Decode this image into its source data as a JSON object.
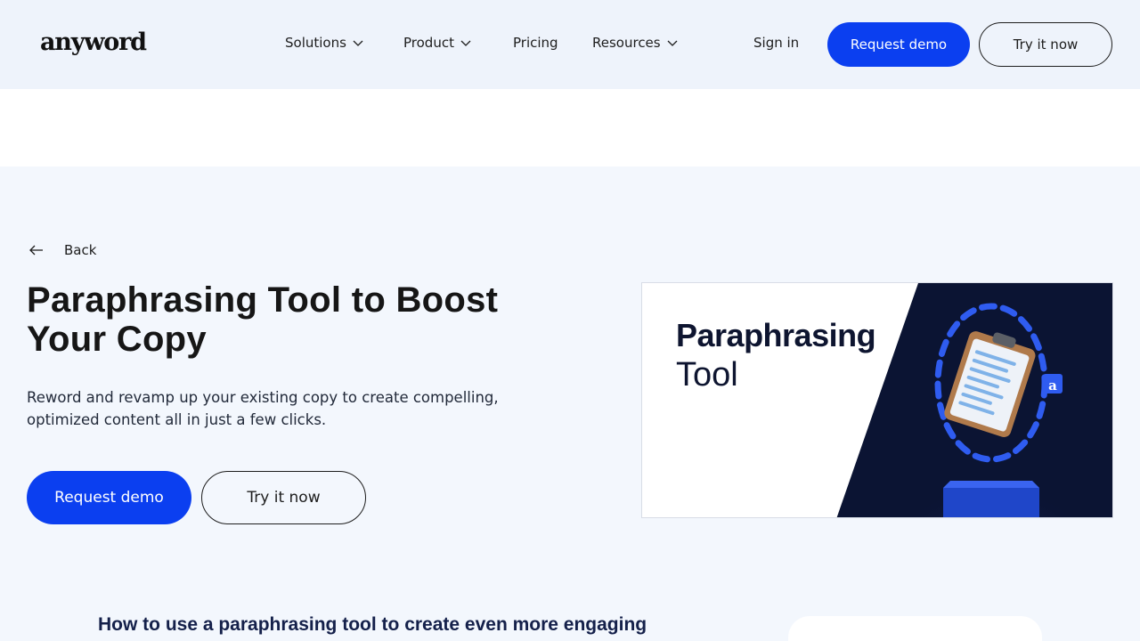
{
  "header": {
    "logo": "anyword",
    "nav": [
      {
        "label": "Solutions",
        "icon": "chevron-down-icon"
      },
      {
        "label": "Product",
        "icon": "chevron-down-icon"
      },
      {
        "label": "Pricing"
      },
      {
        "label": "Resources",
        "icon": "chevron-down-icon"
      }
    ],
    "sign_in": "Sign in",
    "request_demo": "Request demo",
    "try_now": "Try it now"
  },
  "hero": {
    "back_label": "Back",
    "back_icon": "arrow-left-icon",
    "title": "Paraphrasing Tool to Boost Your Copy",
    "description": "Reword and revamp up your existing copy to create compelling, optimized content all in just a few clicks.",
    "request_demo": "Request demo",
    "try_now": "Try it now",
    "image": {
      "title": "Paraphrasing",
      "subtitle": "Tool",
      "badge_letter": "a"
    }
  },
  "section": {
    "heading": "How to use a paraphrasing tool to create even more engaging"
  },
  "colors": {
    "accent": "#0b3ff0",
    "header_bg": "#eef3fb",
    "page_bg": "#f3f7fd",
    "image_dark": "#0b1433"
  }
}
